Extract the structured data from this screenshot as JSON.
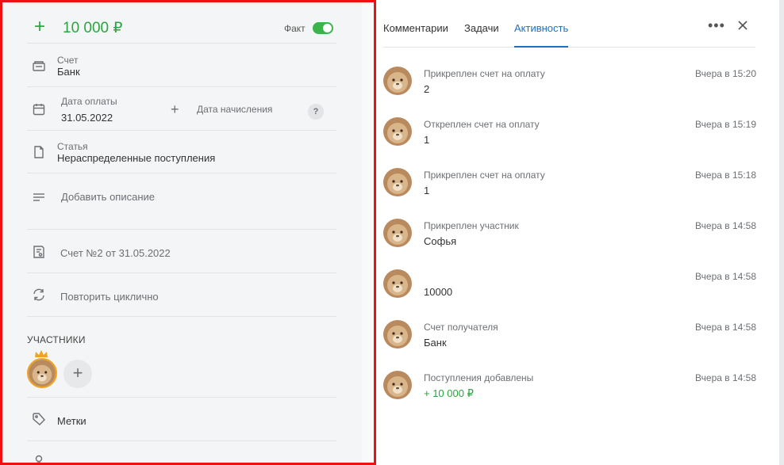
{
  "left": {
    "amount_sign": "+",
    "amount": "10 000 ₽",
    "fact_label": "Факт",
    "account_label": "Счет",
    "account_value": "Банк",
    "payment_date_label": "Дата оплаты",
    "payment_date_value": "31.05.2022",
    "accrual_plus": "+",
    "accrual_date_label": "Дата начисления",
    "help": "?",
    "article_label": "Статья",
    "article_value": "Нераспределенные поступления",
    "add_description": "Добавить описание",
    "invoice": "Счет №2 от 31.05.2022",
    "repeat": "Повторить циклично",
    "participants_title": "УЧАСТНИКИ",
    "add_participant": "+",
    "tags": "Метки",
    "toggle_color": "#3bb54a",
    "accent_green": "#2da440"
  },
  "right": {
    "tabs": [
      "Комментарии",
      "Задачи",
      "Активность"
    ],
    "active_tab": "Активность",
    "more": "•••",
    "activity": [
      {
        "title": "Прикреплен счет на оплату",
        "value": "2",
        "time": "Вчера в 15:20"
      },
      {
        "title": "Откреплен счет на оплату",
        "value": "1",
        "time": "Вчера в 15:19"
      },
      {
        "title": "Прикреплен счет на оплату",
        "value": "1",
        "time": "Вчера в 15:18"
      },
      {
        "title": "Прикреплен участник",
        "value": "Софья",
        "time": "Вчера в 14:58"
      },
      {
        "title": "",
        "value": "10000",
        "time": "Вчера в 14:58"
      },
      {
        "title": "Счет получателя",
        "value": "Банк",
        "time": "Вчера в 14:58"
      },
      {
        "title": "Поступления добавлены",
        "value": "+ 10 000 ₽",
        "time": "Вчера в 14:58"
      }
    ],
    "accent_blue": "#1f6fbf"
  }
}
